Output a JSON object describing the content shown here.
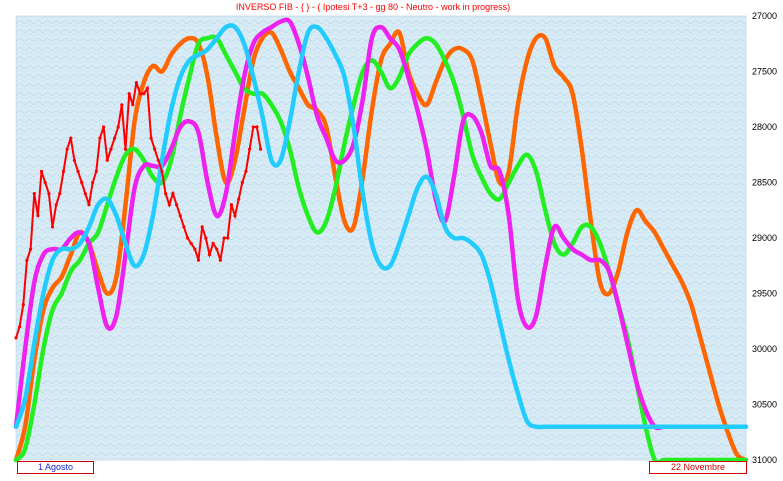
{
  "chart_data": {
    "type": "line",
    "title": "INVERSO FIB  -  { }  - ( Ipotesi T+3  - gg 80  -  Neutro - work in progress)",
    "date_labels": {
      "start": "1 Agosto",
      "end": "22 Novembre"
    },
    "y_axis": {
      "position": "right",
      "inverted": true,
      "ylim": [
        27000,
        31000
      ],
      "ticks": [
        "27000",
        "27500",
        "28000",
        "28500",
        "29000",
        "29500",
        "30000",
        "30500",
        "31000"
      ]
    },
    "x_range": [
      0,
      80
    ],
    "grid": false,
    "colors": {
      "background": "#d9ecf6",
      "orange": "#ff6600",
      "green": "#22ee22",
      "magenta": "#ee22ee",
      "cyan": "#22ccff",
      "price": "#ff0000",
      "title": "#ff0000"
    },
    "series": [
      {
        "color": "orange",
        "x": [
          0,
          1,
          2,
          3,
          4,
          5,
          6,
          7,
          8,
          9,
          10,
          11,
          12,
          13,
          14,
          15,
          16,
          17,
          18,
          19,
          20,
          21,
          22,
          23,
          24,
          25,
          26,
          27,
          28,
          29,
          30,
          31,
          32,
          33,
          34,
          35,
          36,
          37,
          38,
          39,
          40,
          41,
          42,
          43,
          44,
          45,
          46,
          47,
          48,
          49,
          50,
          51,
          52,
          53,
          54,
          55,
          56,
          57,
          58,
          59,
          60,
          61,
          62,
          63,
          64,
          65,
          66,
          67,
          68,
          69,
          70,
          71,
          72,
          73,
          74,
          75,
          76,
          77,
          78,
          79,
          80
        ],
        "values": [
          31000,
          30700,
          30100,
          29650,
          29450,
          29350,
          29150,
          28950,
          29050,
          29300,
          29500,
          29350,
          28700,
          27950,
          27600,
          27450,
          27500,
          27350,
          27250,
          27200,
          27250,
          27550,
          28100,
          28500,
          28300,
          27850,
          27400,
          27200,
          27150,
          27300,
          27500,
          27650,
          27800,
          27850,
          28000,
          28450,
          28850,
          28900,
          28450,
          27850,
          27400,
          27250,
          27150,
          27500,
          27700,
          27800,
          27600,
          27400,
          27300,
          27300,
          27400,
          27750,
          28150,
          28500,
          28400,
          27800,
          27400,
          27200,
          27200,
          27450,
          27550,
          27700,
          28200,
          28850,
          29400,
          29500,
          29300,
          28950,
          28750,
          28850,
          28950,
          29100,
          29250,
          29400,
          29600,
          29900,
          30200,
          30500,
          30750,
          30950,
          31000
        ]
      },
      {
        "color": "green",
        "x": [
          0,
          1,
          2,
          3,
          4,
          5,
          6,
          7,
          8,
          9,
          10,
          11,
          12,
          13,
          14,
          15,
          16,
          17,
          18,
          19,
          20,
          21,
          22,
          23,
          24,
          25,
          26,
          27,
          28,
          29,
          30,
          31,
          32,
          33,
          34,
          35,
          36,
          37,
          38,
          39,
          40,
          41,
          42,
          43,
          44,
          45,
          46,
          47,
          48,
          49,
          50,
          51,
          52,
          53,
          54,
          55,
          56,
          57,
          58,
          59,
          60,
          61,
          62,
          63,
          64,
          65,
          66,
          67,
          68,
          69,
          70,
          71,
          72,
          73,
          74,
          75,
          76,
          77,
          78,
          79,
          80
        ],
        "values": [
          31000,
          30900,
          30500,
          30000,
          29650,
          29500,
          29300,
          29200,
          29050,
          28950,
          28700,
          28450,
          28250,
          28200,
          28300,
          28450,
          28500,
          28300,
          27900,
          27550,
          27250,
          27200,
          27200,
          27350,
          27500,
          27650,
          27700,
          27700,
          27800,
          27950,
          28200,
          28550,
          28800,
          28950,
          28850,
          28550,
          28150,
          27800,
          27500,
          27400,
          27500,
          27650,
          27550,
          27350,
          27250,
          27200,
          27250,
          27400,
          27600,
          27900,
          28250,
          28450,
          28600,
          28650,
          28500,
          28350,
          28250,
          28400,
          28750,
          29050,
          29150,
          29050,
          28900,
          28900,
          29050,
          29300,
          29600,
          29900,
          30300,
          30700,
          31000,
          31000,
          31000,
          31000,
          31000,
          31000,
          31000,
          31000,
          31000,
          31000,
          31000
        ]
      },
      {
        "color": "magenta",
        "x": [
          0,
          1,
          2,
          3,
          4,
          5,
          6,
          7,
          8,
          9,
          10,
          11,
          12,
          13,
          14,
          15,
          16,
          17,
          18,
          19,
          20,
          21,
          22,
          23,
          24,
          25,
          26,
          27,
          28,
          29,
          30,
          31,
          32,
          33,
          34,
          35,
          36,
          37,
          38,
          39,
          40,
          41,
          42,
          43,
          44,
          45,
          46,
          47,
          48,
          49,
          50,
          51,
          52,
          53,
          54,
          55,
          56,
          57,
          58,
          59,
          60,
          61,
          62,
          63,
          64,
          65,
          66,
          67,
          68,
          69,
          70,
          71,
          72,
          73,
          74,
          75,
          76,
          77,
          78,
          79,
          80
        ],
        "values": [
          30700,
          30000,
          29400,
          29150,
          29100,
          29100,
          29000,
          28950,
          29050,
          29450,
          29800,
          29700,
          29150,
          28550,
          28350,
          28350,
          28350,
          28200,
          28000,
          27950,
          28050,
          28500,
          28800,
          28600,
          28050,
          27550,
          27250,
          27150,
          27100,
          27050,
          27050,
          27250,
          27550,
          27900,
          28100,
          28300,
          28300,
          28150,
          27750,
          27200,
          27100,
          27200,
          27300,
          27550,
          27850,
          28200,
          28650,
          28850,
          28450,
          27950,
          27900,
          28050,
          28350,
          28400,
          28800,
          29550,
          29800,
          29700,
          29250,
          28900,
          29000,
          29100,
          29150,
          29200,
          29200,
          29300,
          29600,
          29950,
          30300,
          30550,
          30700,
          30700,
          30700,
          30700,
          30700,
          30700,
          30700,
          30700,
          30700,
          30700,
          30700
        ]
      },
      {
        "color": "cyan",
        "x": [
          0,
          1,
          2,
          3,
          4,
          5,
          6,
          7,
          8,
          9,
          10,
          11,
          12,
          13,
          14,
          15,
          16,
          17,
          18,
          19,
          20,
          21,
          22,
          23,
          24,
          25,
          26,
          27,
          28,
          29,
          30,
          31,
          32,
          33,
          34,
          35,
          36,
          37,
          38,
          39,
          40,
          41,
          42,
          43,
          44,
          45,
          46,
          47,
          48,
          49,
          50,
          51,
          52,
          53,
          54,
          55,
          56,
          57,
          58,
          59,
          60,
          61,
          62,
          63,
          64,
          65,
          66,
          67,
          68,
          69,
          70,
          71,
          72,
          73,
          74,
          75,
          76,
          77,
          78,
          79,
          80
        ],
        "values": [
          30700,
          30450,
          29950,
          29500,
          29200,
          29100,
          29100,
          29050,
          28900,
          28700,
          28650,
          28800,
          29050,
          29250,
          29150,
          28800,
          28300,
          27850,
          27550,
          27400,
          27350,
          27300,
          27200,
          27100,
          27100,
          27250,
          27550,
          27900,
          28300,
          28300,
          27950,
          27500,
          27150,
          27100,
          27200,
          27350,
          27550,
          28000,
          28600,
          29050,
          29250,
          29250,
          29050,
          28800,
          28550,
          28450,
          28600,
          28900,
          29000,
          29000,
          29050,
          29150,
          29400,
          29750,
          30100,
          30400,
          30650,
          30700,
          30700,
          30700,
          30700,
          30700,
          30700,
          30700,
          30700,
          30700,
          30700,
          30700,
          30700,
          30700,
          30700,
          30700,
          30700,
          30700,
          30700,
          30700,
          30700,
          30700,
          30700,
          30700,
          30700
        ]
      },
      {
        "color": "price",
        "x": [
          0,
          0.4,
          0.8,
          1.2,
          1.6,
          2.0,
          2.4,
          2.8,
          3.2,
          3.6,
          4.0,
          4.4,
          4.8,
          5.2,
          5.6,
          6.0,
          6.4,
          6.8,
          7.2,
          7.6,
          8.0,
          8.4,
          8.8,
          9.2,
          9.6,
          10.0,
          10.4,
          10.8,
          11.2,
          11.6,
          12.0,
          12.4,
          12.8,
          13.2,
          13.6,
          14.0,
          14.4,
          14.8,
          15.2,
          15.6,
          16.0,
          16.4,
          16.8,
          17.2,
          17.6,
          18.0,
          18.4,
          18.8,
          19.2,
          19.6,
          20.0,
          20.4,
          20.8,
          21.2,
          21.6,
          22.0,
          22.4,
          22.8,
          23.2,
          23.6,
          24.0,
          24.4,
          24.8,
          25.2,
          25.6,
          26.0,
          26.4,
          26.8
        ],
        "values": [
          29900,
          29800,
          29600,
          29200,
          29100,
          28600,
          28800,
          28400,
          28500,
          28600,
          28900,
          28700,
          28600,
          28400,
          28200,
          28100,
          28300,
          28400,
          28500,
          28600,
          28700,
          28500,
          28400,
          28100,
          28000,
          28300,
          28200,
          28100,
          28000,
          27800,
          28200,
          27700,
          27800,
          27600,
          27700,
          27700,
          27650,
          28100,
          28200,
          28300,
          28400,
          28600,
          28700,
          28600,
          28700,
          28800,
          28900,
          29000,
          29050,
          29100,
          29200,
          28900,
          29000,
          29150,
          29050,
          29100,
          29200,
          29000,
          29000,
          28700,
          28800,
          28650,
          28500,
          28400,
          28200,
          28000,
          28000,
          28200
        ]
      }
    ]
  }
}
